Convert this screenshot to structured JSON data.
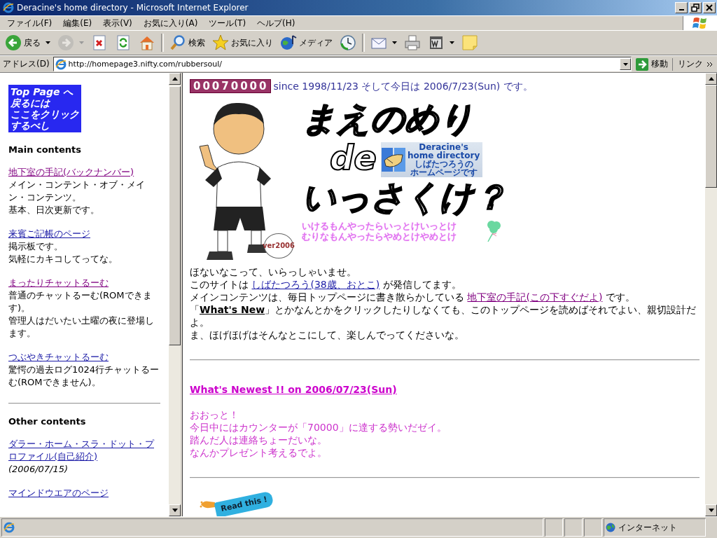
{
  "window": {
    "title": "Deracine's home directory - Microsoft Internet Explorer"
  },
  "menu_bar": [
    "ファイル(F)",
    "編集(E)",
    "表示(V)",
    "お気に入り(A)",
    "ツール(T)",
    "ヘルプ(H)"
  ],
  "toolbar": [
    {
      "kind": "back",
      "label": "戻る",
      "dropdown": true,
      "disabled": false
    },
    {
      "kind": "forward",
      "dropdown": true,
      "disabled": true
    },
    {
      "kind": "stop",
      "dropdown": false,
      "disabled": false
    },
    {
      "kind": "refresh",
      "dropdown": false,
      "disabled": false
    },
    {
      "kind": "home",
      "dropdown": false,
      "disabled": false
    },
    {
      "kind": "separator"
    },
    {
      "kind": "search",
      "label": "検索",
      "dropdown": false,
      "disabled": false
    },
    {
      "kind": "favorites",
      "label": "お気に入り",
      "dropdown": false,
      "disabled": false
    },
    {
      "kind": "media",
      "label": "メディア",
      "dropdown": false,
      "disabled": false
    },
    {
      "kind": "history",
      "dropdown": false,
      "disabled": false
    },
    {
      "kind": "separator"
    },
    {
      "kind": "mail",
      "dropdown": true,
      "disabled": false
    },
    {
      "kind": "print",
      "dropdown": false,
      "disabled": false
    },
    {
      "kind": "edit",
      "dropdown": true,
      "disabled": false
    },
    {
      "kind": "note",
      "dropdown": false,
      "disabled": false
    }
  ],
  "address_bar": {
    "label": "アドレス(D)",
    "value": "http://homepage3.nifty.com/rubbersoul/",
    "go": "移動",
    "links": "リンク"
  },
  "left_frame": {
    "banner": [
      "Top Page へ",
      "戻るには",
      "ここをクリック",
      "するべし"
    ],
    "sections": [
      {
        "heading": "Main contents",
        "items": [
          {
            "link": "地下室の手記(バックナンバー)",
            "visited": true,
            "description": [
              "メイン・コンテント・オブ・メイン・コンテンツ。",
              "基本、日次更新です。"
            ]
          },
          {
            "link": "来賓ご記帳のページ",
            "visited": false,
            "description": [
              "掲示板です。",
              "気軽にカキコしてってな。"
            ]
          },
          {
            "link": "まったりチャットるーむ",
            "visited": true,
            "description": [
              "普通のチャットるーむ(ROMできます)。",
              "管理人はだいたい土曜の夜に登場します。"
            ]
          },
          {
            "link": "つぶやきチャットるーむ",
            "visited": false,
            "description": [
              "驚愕の過去ログ1024行チャットるーむ(ROMできません)。"
            ]
          }
        ]
      },
      {
        "heading": "Other contents",
        "items": [
          {
            "link": "ダラー・ホーム・スラ・ドット・プロファイル(自己紹介)",
            "visited": false,
            "note": "(2006/07/15)"
          },
          {
            "link": "マインドウエアのページ",
            "visited": false
          }
        ]
      }
    ]
  },
  "right_frame": {
    "counter": "00070000",
    "since": "since 1998/11/23 そして今日は 2006/7/23(Sun) です。",
    "badge": "ver2006",
    "logo": [
      "まえのめり",
      "de",
      "いっさくけ？"
    ],
    "banner": [
      "Deracine's",
      "home directory",
      "しばたつろうの",
      "ホームページです"
    ],
    "tagline": [
      "いけるもんやったらいっとけいっとけ",
      "むりなもんやったらやめとけやめとけ"
    ],
    "intro": [
      [
        {
          "kind": "text",
          "text": "ほないなこって、いらっしゃいませ。"
        }
      ],
      [
        {
          "kind": "text",
          "text": "このサイトは "
        },
        {
          "kind": "link",
          "text": "しばたつろう(38歳、おとこ)",
          "visited": false
        },
        {
          "kind": "text",
          "text": " が発信してます。"
        }
      ],
      [
        {
          "kind": "text",
          "text": "メインコンテンツは、毎日トップページに書き散らかしている "
        },
        {
          "kind": "link",
          "text": "地下室の手記(この下すぐだよ)",
          "visited": true
        },
        {
          "kind": "text",
          "text": " です。"
        }
      ],
      [
        {
          "kind": "text",
          "text": "「"
        },
        {
          "kind": "strong_link",
          "text": "What's New"
        },
        {
          "kind": "text",
          "text": "」とかなんとかをクリックしたりしなくても、このトップページを読めばそれでよい、親切設計だよ。"
        }
      ],
      [
        {
          "kind": "text",
          "text": "ま、ほげほげはそんなとこにして、楽しんでってくださいな。"
        }
      ]
    ],
    "news": {
      "heading": "What's Newest !! on 2006/07/23(Sun)",
      "lines": [
        "おおっと！",
        "今日中にはカウンターが「70000」に達する勢いだゼイ。",
        "踏んだ人は連絡ちょーだいな。",
        "なんかプレゼント考えるでよ。"
      ]
    },
    "read_this": "Read this !"
  },
  "status_bar": {
    "zone": "インターネット"
  }
}
